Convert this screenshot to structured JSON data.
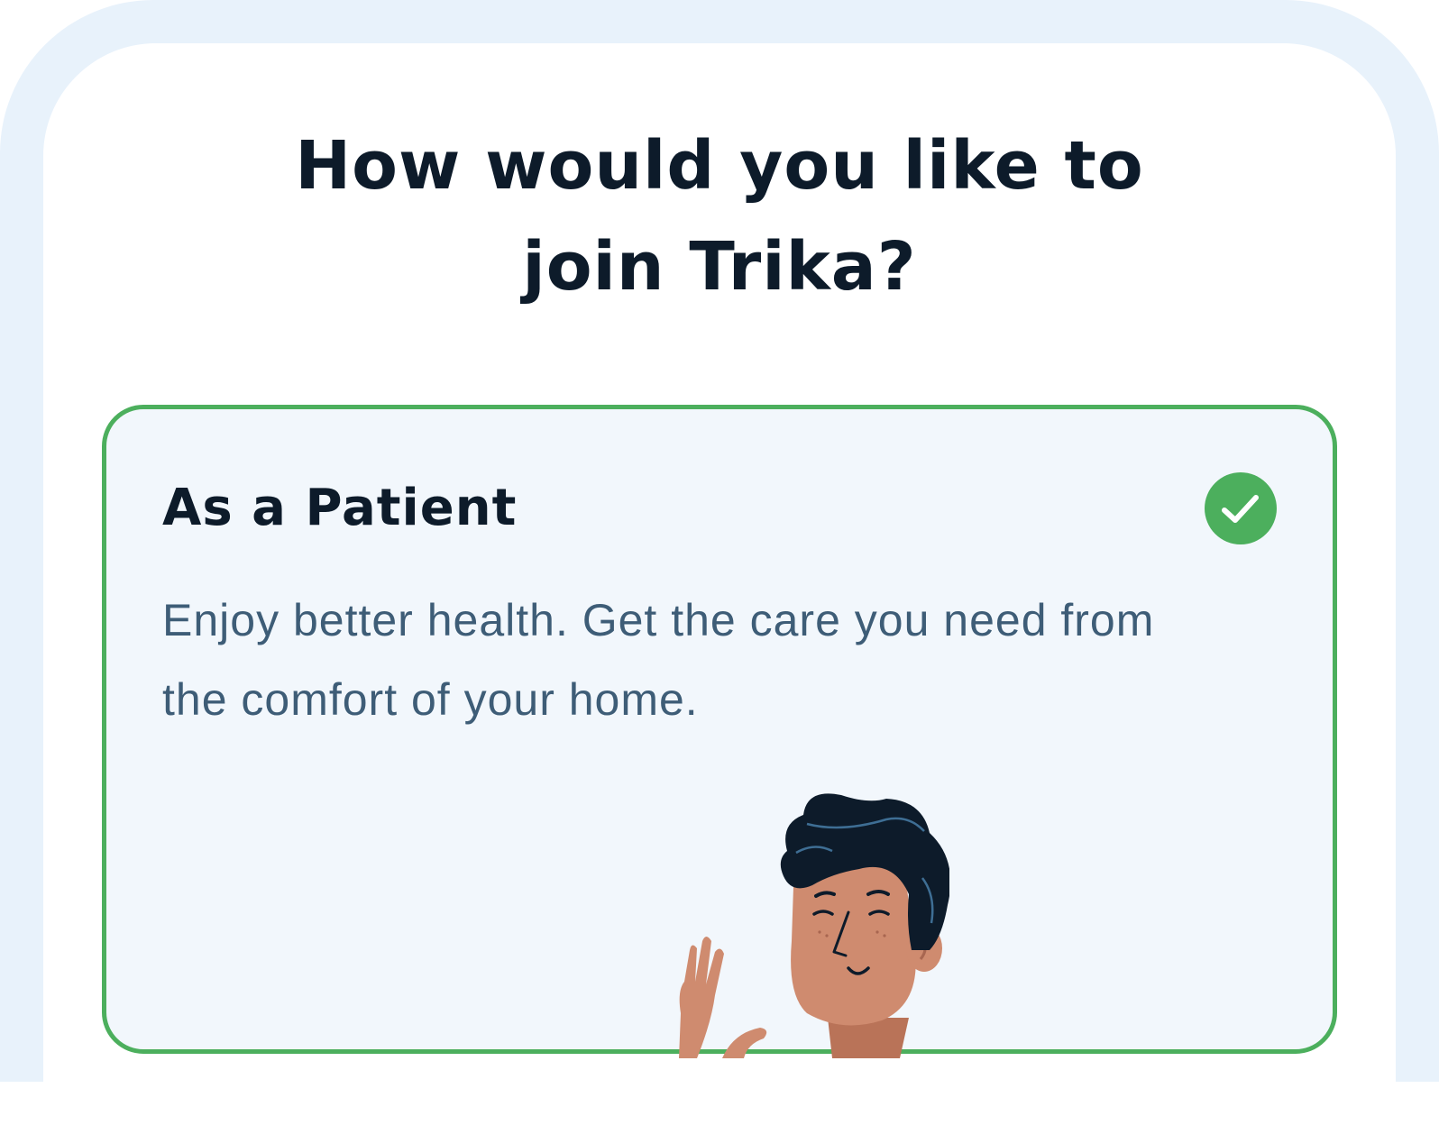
{
  "page": {
    "heading_line1": "How would you like to",
    "heading_line2": "join Trika?"
  },
  "option": {
    "title": "As a Patient",
    "description": "Enjoy better health. Get the care you need from the comfort of your home.",
    "selected": true,
    "selected_icon": "check-icon",
    "illustration": "patient-waving-illustration"
  },
  "colors": {
    "accent_green": "#4caf5d",
    "heading_text": "#0d1b2a",
    "body_text": "#3e5d77",
    "card_background": "#f2f7fc",
    "frame_background": "#e8f2fb"
  }
}
